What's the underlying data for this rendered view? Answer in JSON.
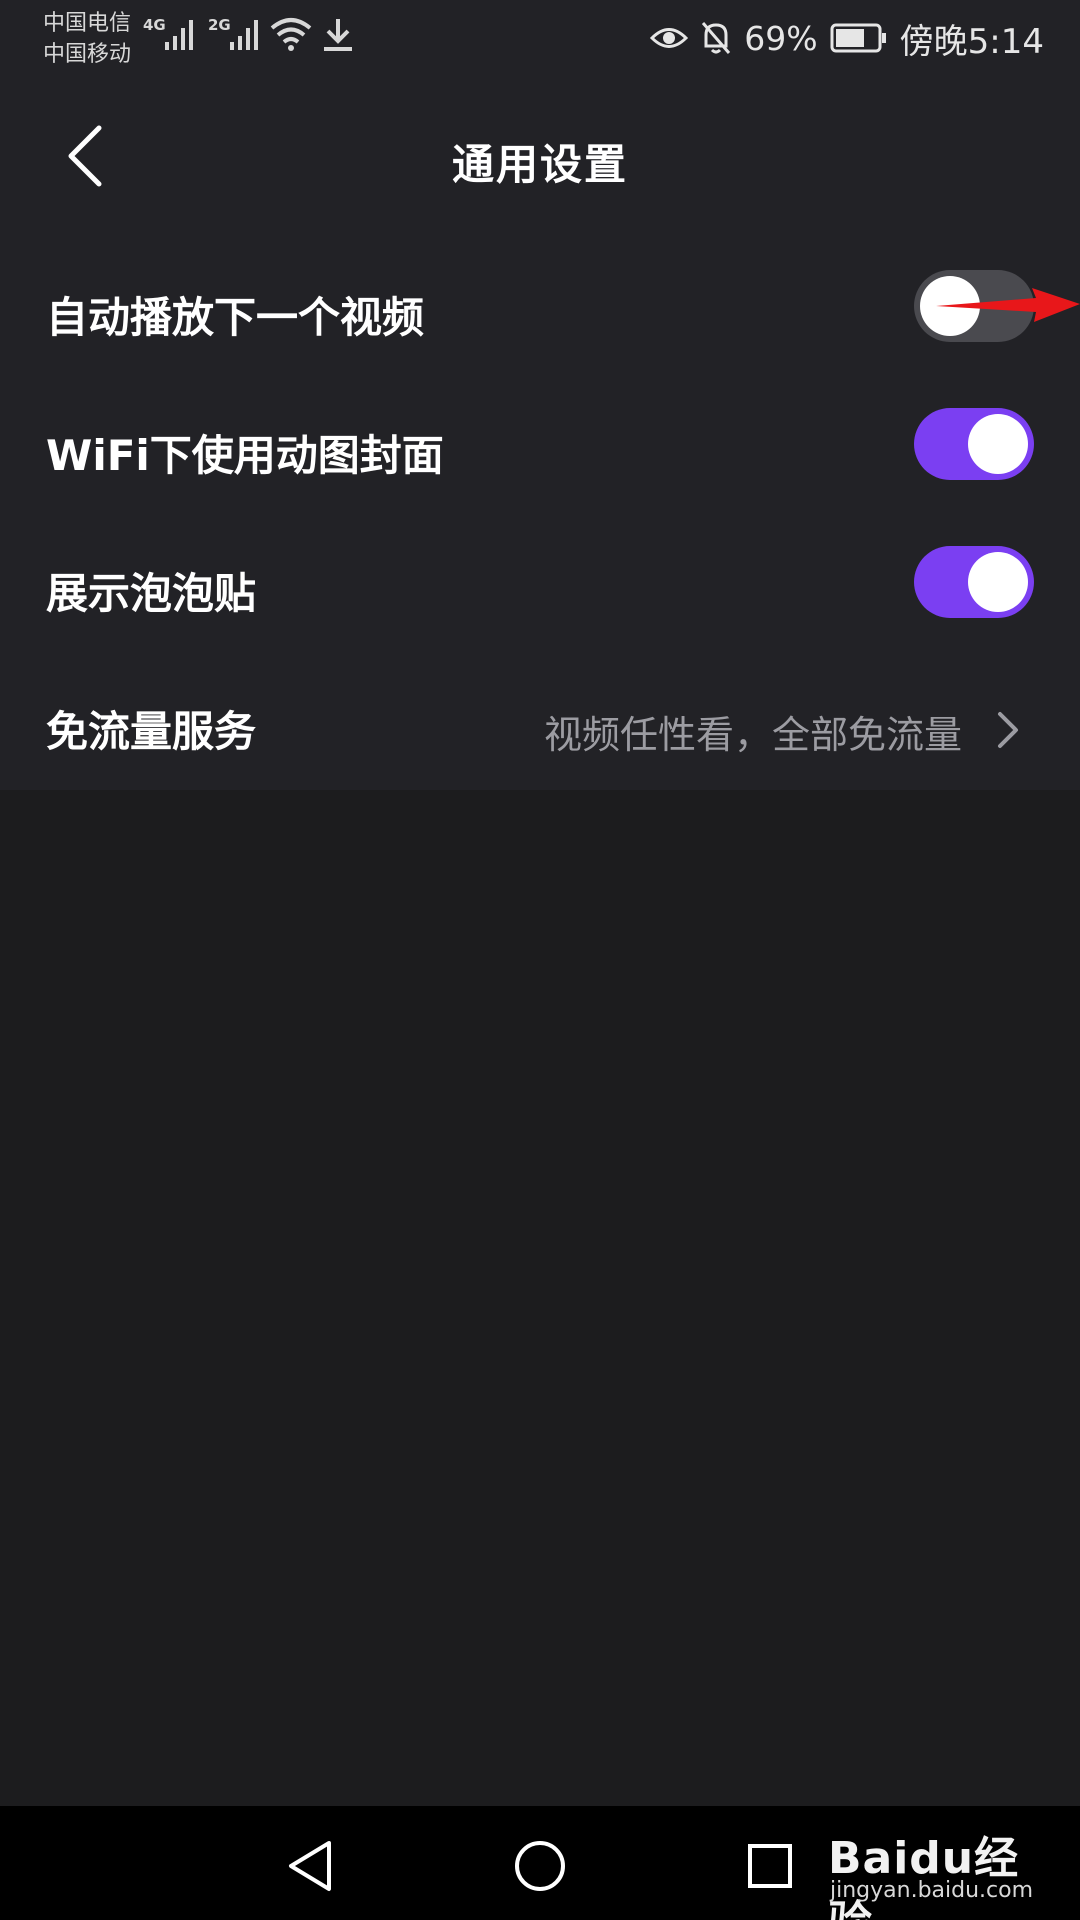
{
  "status_bar": {
    "carrier_1": "中国电信",
    "carrier_2": "中国移动",
    "signal_1_type": "4G",
    "signal_2_type": "2G",
    "battery_percent": "69%",
    "time": "傍晚5:14"
  },
  "header": {
    "title": "通用设置"
  },
  "settings": {
    "items": [
      {
        "label": "自动播放下一个视频",
        "toggle_on": false
      },
      {
        "label": "WiFi下使用动图封面",
        "toggle_on": true
      },
      {
        "label": "展示泡泡贴",
        "toggle_on": true
      },
      {
        "label": "免流量服务",
        "value": "视频任性看，全部免流量"
      }
    ]
  },
  "watermark": {
    "logo_text": "Baidu经验",
    "url": "jingyan.baidu.com"
  },
  "colors": {
    "accent": "#7b3ff2",
    "toggle_off": "#4a4a4f",
    "background": "#1c1c1e",
    "annotation_arrow": "#e8171a"
  }
}
